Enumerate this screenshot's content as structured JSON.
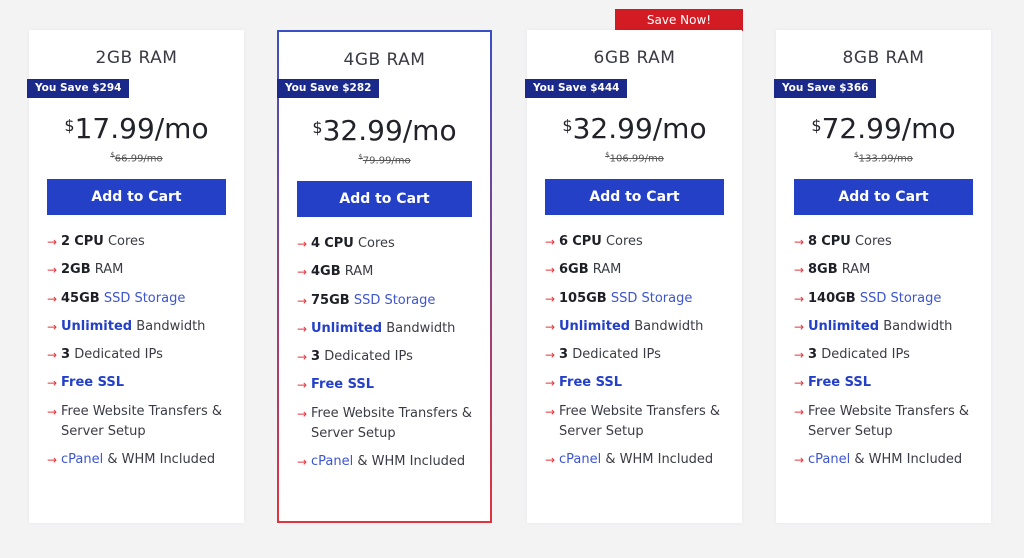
{
  "promo_badge": "Save Now!",
  "plans": [
    {
      "title": "2GB RAM",
      "save": "You Save $294",
      "currency": "$",
      "price": "17.99/mo",
      "old_currency": "$",
      "old_price": "66.99/mo",
      "button": "Add to Cart",
      "features": {
        "cpu_num": "2",
        "cpu_bold": "CPU",
        "cpu_text": "Cores",
        "ram_bold": "2GB",
        "ram_text": "RAM",
        "storage_bold": "45GB",
        "storage_text": "SSD Storage",
        "bw_bold": "Unlimited",
        "bw_text": "Bandwidth",
        "ip_bold": "3",
        "ip_text": "Dedicated IPs",
        "ssl": "Free SSL",
        "transfer": "Free Website Transfers & Server Setup",
        "cpanel": "cPanel",
        "cpanel_text": "& WHM Included"
      }
    },
    {
      "title": "4GB RAM",
      "save": "You Save $282",
      "currency": "$",
      "price": "32.99/mo",
      "old_currency": "$",
      "old_price": "79.99/mo",
      "button": "Add to Cart",
      "features": {
        "cpu_num": "4",
        "cpu_bold": "CPU",
        "cpu_text": "Cores",
        "ram_bold": "4GB",
        "ram_text": "RAM",
        "storage_bold": "75GB",
        "storage_text": "SSD Storage",
        "bw_bold": "Unlimited",
        "bw_text": "Bandwidth",
        "ip_bold": "3",
        "ip_text": "Dedicated IPs",
        "ssl": "Free SSL",
        "transfer": "Free Website Transfers & Server Setup",
        "cpanel": "cPanel",
        "cpanel_text": "& WHM Included"
      }
    },
    {
      "title": "6GB RAM",
      "save": "You Save $444",
      "currency": "$",
      "price": "32.99/mo",
      "old_currency": "$",
      "old_price": "106.99/mo",
      "button": "Add to Cart",
      "features": {
        "cpu_num": "6",
        "cpu_bold": "CPU",
        "cpu_text": "Cores",
        "ram_bold": "6GB",
        "ram_text": "RAM",
        "storage_bold": "105GB",
        "storage_text": "SSD Storage",
        "bw_bold": "Unlimited",
        "bw_text": "Bandwidth",
        "ip_bold": "3",
        "ip_text": "Dedicated IPs",
        "ssl": "Free SSL",
        "transfer": "Free Website Transfers & Server Setup",
        "cpanel": "cPanel",
        "cpanel_text": "& WHM Included"
      }
    },
    {
      "title": "8GB RAM",
      "save": "You Save $366",
      "currency": "$",
      "price": "72.99/mo",
      "old_currency": "$",
      "old_price": "133.99/mo",
      "button": "Add to Cart",
      "features": {
        "cpu_num": "8",
        "cpu_bold": "CPU",
        "cpu_text": "Cores",
        "ram_bold": "8GB",
        "ram_text": "RAM",
        "storage_bold": "140GB",
        "storage_text": "SSD Storage",
        "bw_bold": "Unlimited",
        "bw_text": "Bandwidth",
        "ip_bold": "3",
        "ip_text": "Dedicated IPs",
        "ssl": "Free SSL",
        "transfer": "Free Website Transfers & Server Setup",
        "cpanel": "cPanel",
        "cpanel_text": "& WHM Included"
      }
    }
  ],
  "icons": {
    "feature_arrow": "arrow-right-icon"
  },
  "colors": {
    "button": "#2440c7",
    "badge": "#1b2a8a",
    "promo": "#d31b23",
    "arrow": "#e2353d"
  }
}
